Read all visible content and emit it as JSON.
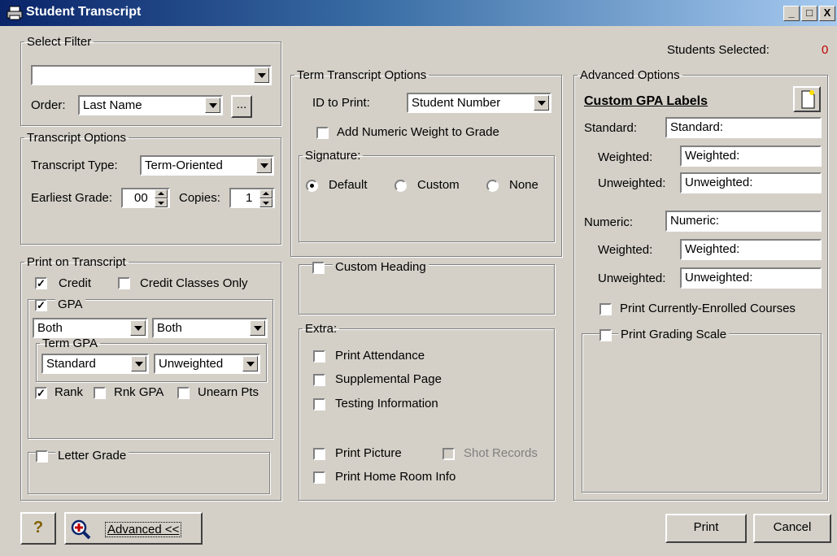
{
  "window": {
    "title": "Student Transcript",
    "minimize": "_",
    "maximize": "□",
    "close": "X"
  },
  "students_selected": {
    "label": "Students Selected:",
    "count": "0"
  },
  "select_filter": {
    "legend": "Select Filter",
    "filter_value": "",
    "order_label": "Order:",
    "order_value": "Last Name",
    "browse_label": "..."
  },
  "transcript_options": {
    "legend": "Transcript Options",
    "type_label": "Transcript Type:",
    "type_value": "Term-Oriented",
    "earliest_label": "Earliest Grade:",
    "earliest_value": "00",
    "copies_label": "Copies:",
    "copies_value": "1"
  },
  "print_on_transcript": {
    "legend": "Print on Transcript",
    "credit": "Credit",
    "credit_classes_only": "Credit Classes Only",
    "gpa": "GPA",
    "gpa_select1": "Both",
    "gpa_select2": "Both",
    "term_gpa_legend": "Term GPA",
    "term_gpa_select1": "Standard",
    "term_gpa_select2": "Unweighted",
    "rank": "Rank",
    "rnk_gpa": "Rnk GPA",
    "unearn_pts": "Unearn Pts",
    "letter_grade": "Letter Grade"
  },
  "term_options": {
    "legend": "Term Transcript Options",
    "id_label": "ID to Print:",
    "id_value": "Student Number",
    "add_weight": "Add Numeric Weight to Grade",
    "signature_legend": "Signature:",
    "sig_default": "Default",
    "sig_custom": "Custom",
    "sig_none": "None",
    "custom_heading": "Custom Heading"
  },
  "extra": {
    "legend": "Extra:",
    "print_attendance": "Print Attendance",
    "supplemental_page": "Supplemental Page",
    "testing_information": "Testing Information",
    "print_picture": "Print Picture",
    "shot_records": "Shot Records",
    "print_home_room": "Print Home Room Info"
  },
  "advanced": {
    "legend": "Advanced Options",
    "custom_gpa_labels": "Custom GPA Labels",
    "standard_label": "Standard:",
    "standard_value": "Standard:",
    "weighted_label": "Weighted:",
    "weighted_value": "Weighted:",
    "unweighted_label": "Unweighted:",
    "unweighted_value": "Unweighted:",
    "numeric_label": "Numeric:",
    "numeric_value": "Numeric:",
    "n_weighted_label": "Weighted:",
    "n_weighted_value": "Weighted:",
    "n_unweighted_label": "Unweighted:",
    "n_unweighted_value": "Unweighted:",
    "print_currently_enrolled": "Print Currently-Enrolled Courses",
    "print_grading_scale": "Print Grading Scale"
  },
  "footer": {
    "help_glyph": "?",
    "advanced_label": "Advanced <<",
    "print": "Print",
    "cancel": "Cancel"
  },
  "colors": {
    "title_start": "#0a246a",
    "title_end": "#a6caf0",
    "count_red": "#c00000",
    "face": "#d4d0c8"
  }
}
